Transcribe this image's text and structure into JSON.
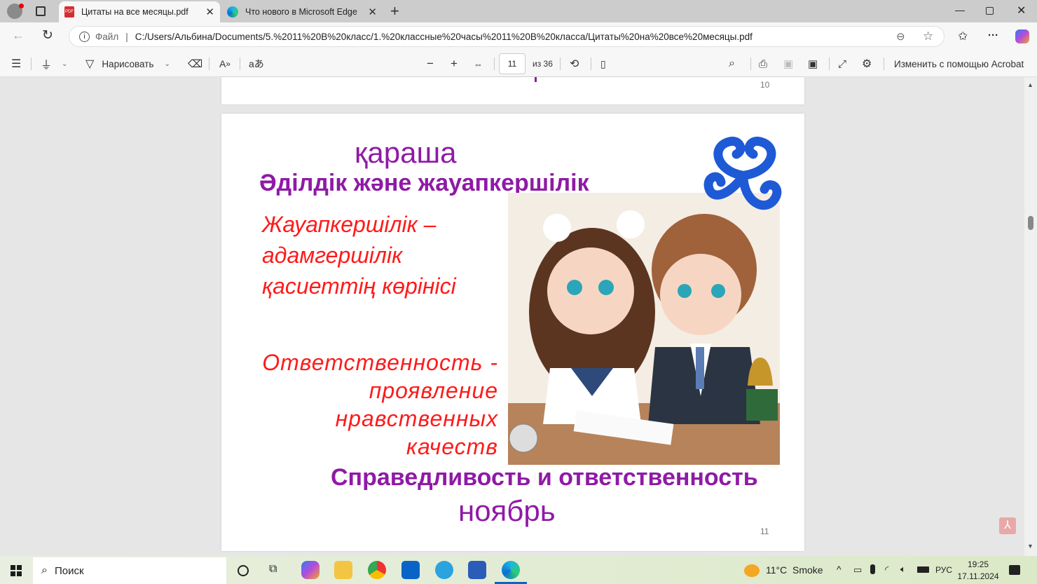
{
  "browser": {
    "tabs": [
      {
        "title": "Цитаты на все месяцы.pdf",
        "active": true
      },
      {
        "title": "Что нового в Microsoft Edge",
        "active": false
      }
    ],
    "address": {
      "scheme_label": "Файл",
      "url": "C:/Users/Альбина/Documents/5.%2011%20В%20класс/1.%20классные%20часы%2011%20В%20класса/Цитаты%20на%20все%20месяцы.pdf"
    }
  },
  "pdf_toolbar": {
    "draw_label": "Нарисовать",
    "page_current": "11",
    "page_total": "из 36",
    "acrobat_label": "Изменить с помощью Acrobat"
  },
  "document": {
    "prev_page_number": "10",
    "page": {
      "month_kz": "қараша",
      "title_kz": "Әділдік және жауапкершілік",
      "quote_kz": [
        "Жауапкершілік –",
        "адамгершілік",
        "қасиеттің көрінісі"
      ],
      "quote_ru": [
        "Ответственность -",
        "проявление",
        "нравственных",
        "качеств"
      ],
      "title_ru": "Справедливость и ответственность",
      "month_ru": "ноябрь",
      "page_number": "11"
    }
  },
  "taskbar": {
    "search_placeholder": "Поиск",
    "weather": "11°C  Smoke",
    "language": "РУС",
    "time": "19:25",
    "date": "17.11.2024"
  },
  "colors": {
    "purple": "#8f1aa6",
    "red": "#ff1a1a"
  }
}
